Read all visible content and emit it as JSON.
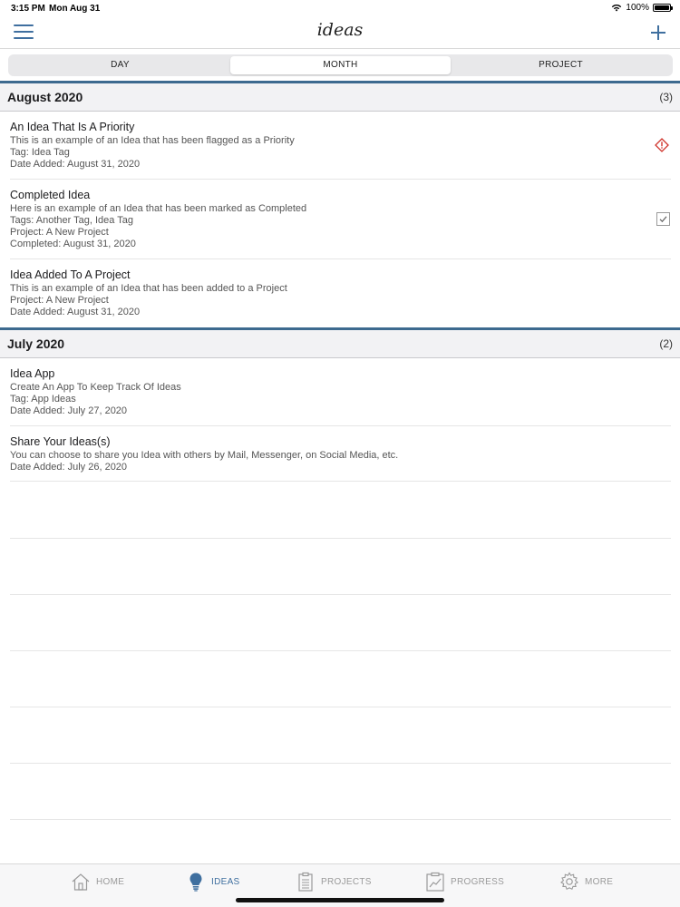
{
  "status_bar": {
    "time": "3:15 PM",
    "date": "Mon Aug 31",
    "battery": "100%"
  },
  "nav": {
    "title": "ideas",
    "menu_icon": "hamburger-icon",
    "add_icon": "plus-icon"
  },
  "segments": {
    "day": "DAY",
    "month": "MONTH",
    "project": "PROJECT",
    "selected": "MONTH"
  },
  "sections": [
    {
      "title": "August 2020",
      "count": "(3)",
      "ideas": [
        {
          "title": "An Idea That Is A Priority",
          "lines": [
            "This is an example of an Idea that has been flagged as a Priority",
            "Tag: Idea Tag",
            "Date Added: August 31, 2020"
          ],
          "status_icon": "priority-warning-icon"
        },
        {
          "title": "Completed Idea",
          "lines": [
            "Here is an example of an Idea that has been marked as Completed",
            "Tags: Another Tag, Idea Tag",
            "Project: A New Project",
            "Completed: August 31, 2020"
          ],
          "status_icon": "completed-check-icon"
        },
        {
          "title": "Idea Added To A Project",
          "lines": [
            "This is an example of an Idea that has been added to a Project",
            "Project: A New Project",
            "Date Added: August 31, 2020"
          ]
        }
      ]
    },
    {
      "title": "July 2020",
      "count": "(2)",
      "ideas": [
        {
          "title": "Idea App",
          "lines": [
            "Create An App To Keep Track Of Ideas",
            "Tag: App Ideas",
            "Date Added: July 27, 2020"
          ]
        },
        {
          "title": "Share Your Ideas(s)",
          "lines": [
            "You can choose to share you Idea with others by Mail, Messenger, on Social Media, etc.",
            "Date Added: July 26, 2020"
          ]
        }
      ]
    }
  ],
  "tab_bar": {
    "home": "HOME",
    "ideas": "IDEAS",
    "projects": "PROJECTS",
    "progress": "PROGRESS",
    "more": "MORE",
    "active": "IDEAS"
  },
  "colors": {
    "accent": "#3f6f9f",
    "section_rule": "#3d6a8f",
    "priority": "#d0342c"
  }
}
